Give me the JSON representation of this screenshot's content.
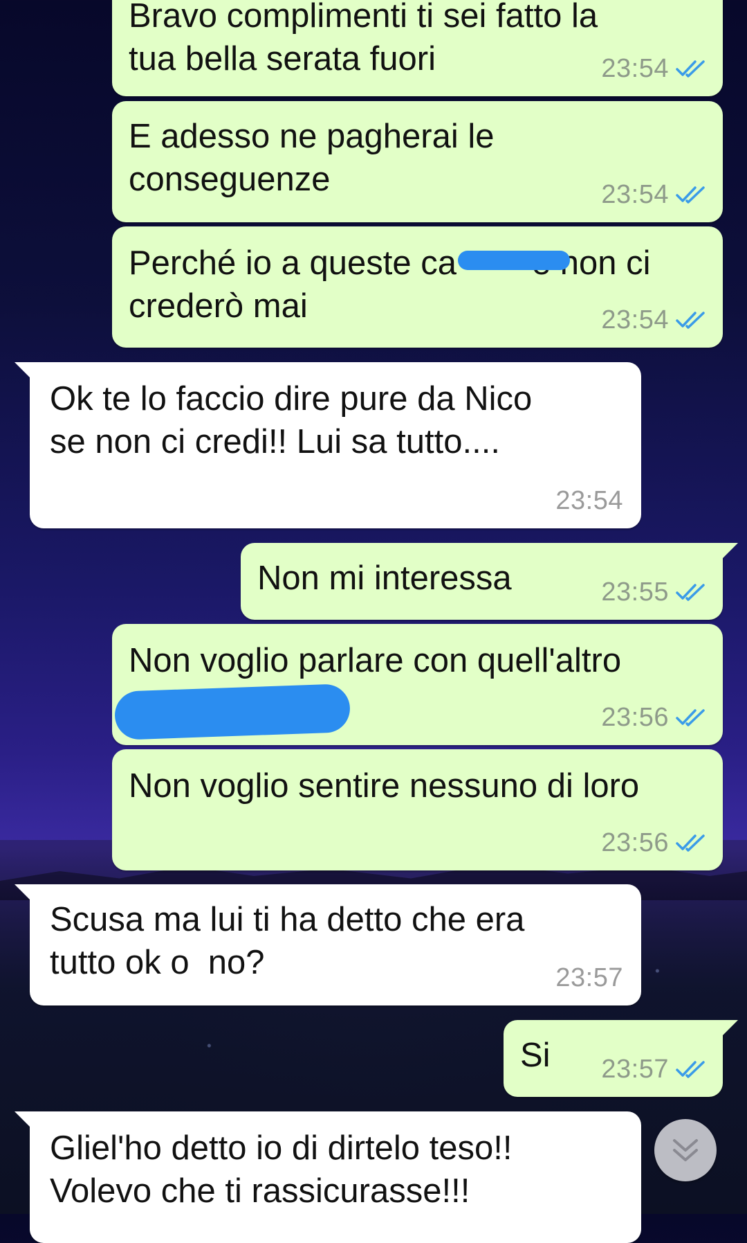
{
  "chat": {
    "messages": [
      {
        "direction": "out",
        "text": "Bravo complimenti ti sei fatto la\ntua bella serata fuori",
        "time": "23:54",
        "status": "read"
      },
      {
        "direction": "out",
        "text": "E adesso ne pagherai le\nconseguenze",
        "time": "23:54",
        "status": "read"
      },
      {
        "direction": "out",
        "text": "Perché io a queste ca        e non ci\ncrederò mai",
        "time": "23:54",
        "status": "read"
      },
      {
        "direction": "in",
        "text": "Ok te lo faccio dire pure da Nico\nse non ci credi!! Lui sa tutto....",
        "time": "23:54"
      },
      {
        "direction": "out",
        "text": "Non mi interessa",
        "time": "23:55",
        "status": "read"
      },
      {
        "direction": "out",
        "text": "Non voglio parlare con quell'altro",
        "time": "23:56",
        "status": "read"
      },
      {
        "direction": "out",
        "text": "Non voglio sentire nessuno di loro",
        "time": "23:56",
        "status": "read"
      },
      {
        "direction": "in",
        "text": "Scusa ma lui ti ha detto che era\ntutto ok o  no?",
        "time": "23:57"
      },
      {
        "direction": "out",
        "text": "Si",
        "time": "23:57",
        "status": "read"
      },
      {
        "direction": "in",
        "text": "Gliel'ho detto io di dirtelo teso!!\nVolevo che ti rassicurasse!!!",
        "time": ""
      }
    ]
  },
  "colors": {
    "outgoing_bubble": "#e2ffc7",
    "incoming_bubble": "#ffffff",
    "read_ticks": "#3a9be8",
    "redaction": "#2b8df0"
  },
  "icons": {
    "read_receipt": "double-check-icon",
    "scroll_down": "double-chevron-down-icon"
  }
}
